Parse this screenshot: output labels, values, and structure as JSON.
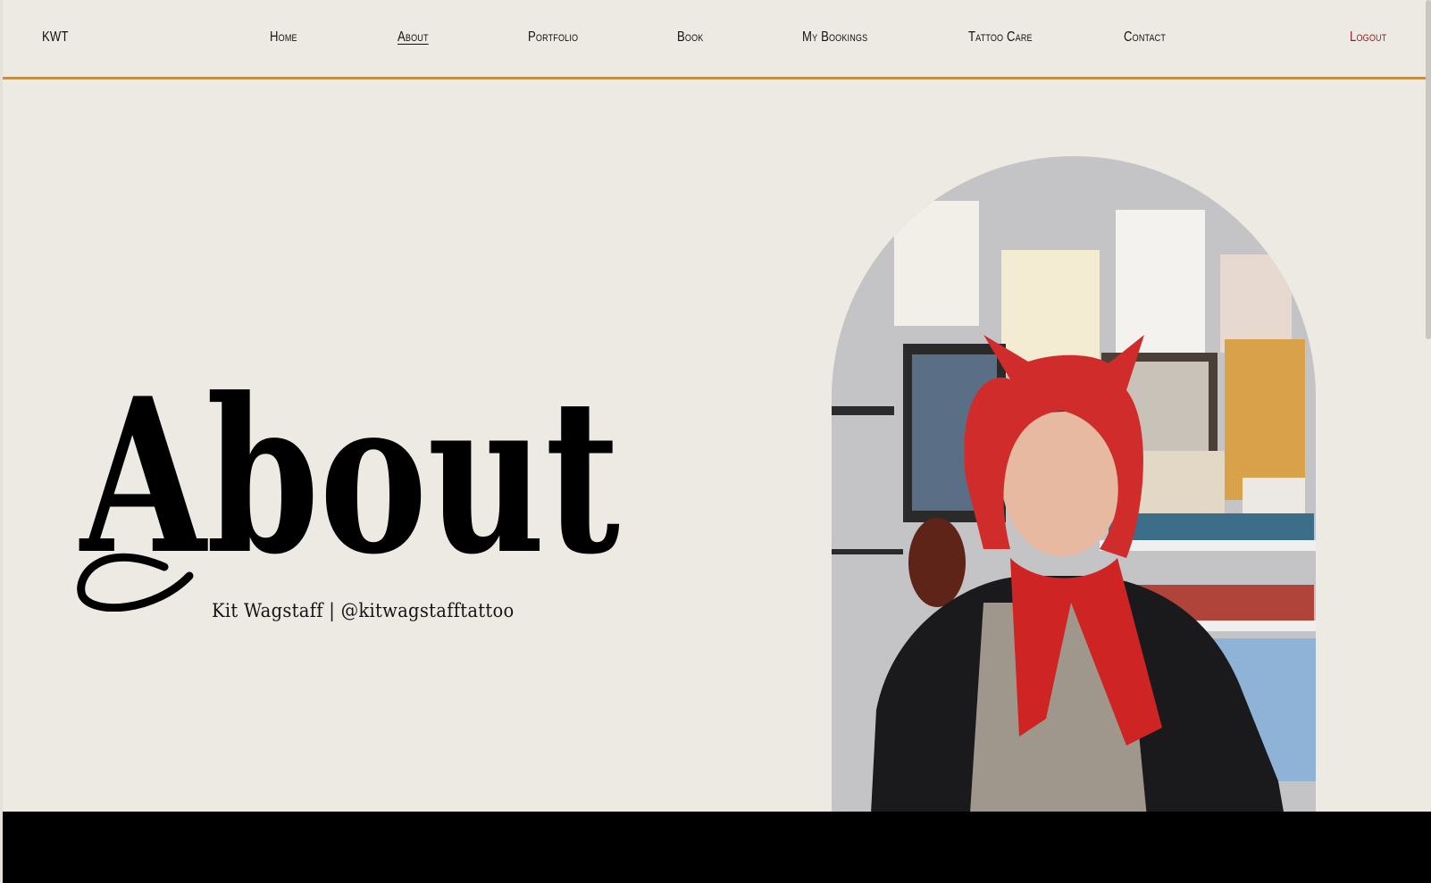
{
  "nav": {
    "brand": "KWT",
    "items": [
      {
        "label": "Home"
      },
      {
        "label": "About"
      },
      {
        "label": "Portfolio"
      },
      {
        "label": "Book"
      },
      {
        "label": "My Bookings"
      },
      {
        "label": "Tattoo Care"
      },
      {
        "label": "Contact"
      }
    ],
    "logout": "Logout"
  },
  "hero": {
    "title": "About",
    "subtitle": "Kit Wagstaff | @kitwagstafftattoo"
  },
  "colors": {
    "background": "#ede9e3",
    "nav_rule": "#c2903e",
    "logout": "#9a1b1b",
    "footer": "#000000"
  }
}
